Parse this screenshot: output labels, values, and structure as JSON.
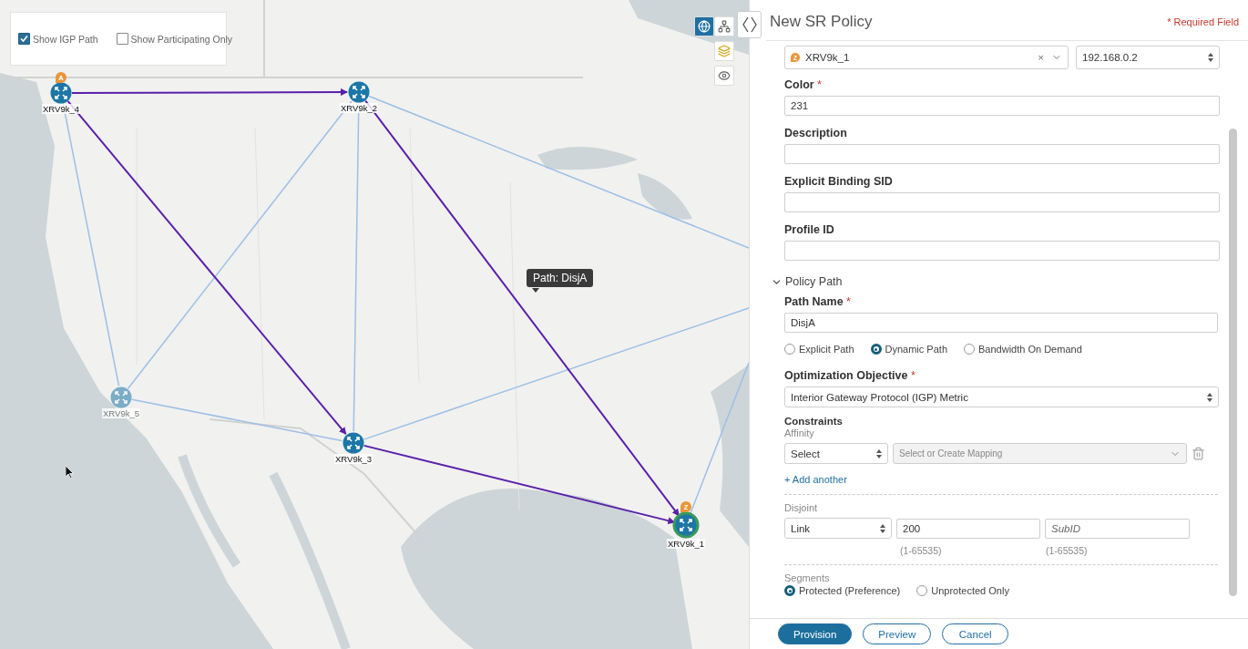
{
  "map": {
    "kind": "picture",
    "legend": [
      {
        "label": "Show IGP Path",
        "checked": true
      },
      {
        "label": "Show Participating Only",
        "checked": false
      }
    ],
    "view_toggle": [
      {
        "kind": "geo",
        "selected": true
      },
      {
        "kind": "topology",
        "selected": false
      }
    ],
    "nodes": [
      {
        "label": "XRV9k_4",
        "marker": "A",
        "dimmed": false,
        "highlighted": false
      },
      {
        "label": "XRV9k_2",
        "dimmed": false,
        "highlighted": false
      },
      {
        "label": "XRV9k_5",
        "dimmed": true,
        "highlighted": false
      },
      {
        "label": "XRV9k_3",
        "dimmed": false,
        "highlighted": false
      },
      {
        "label": "XRV9k_1",
        "marker": "Z",
        "dimmed": false,
        "highlighted": true
      }
    ],
    "links": [
      {
        "kind": "igp"
      },
      {
        "kind": "igp"
      },
      {
        "kind": "igp"
      },
      {
        "kind": "igp"
      },
      {
        "kind": "igp"
      },
      {
        "kind": "igp"
      },
      {
        "kind": "igp"
      },
      {
        "kind": "path"
      },
      {
        "kind": "path"
      },
      {
        "kind": "path"
      },
      {
        "kind": "path"
      }
    ],
    "tooltip": "Path: DisjA"
  },
  "panel": {
    "title": "New SR Policy",
    "required_note": "* Required Field",
    "endpoint": {
      "marker": "Z",
      "value": "XRV9k_1",
      "clear": "×"
    },
    "address": {
      "value": "192.168.0.2"
    },
    "fields": [
      {
        "label": "Color",
        "required": "*",
        "value": "231"
      },
      {
        "label": "Description"
      },
      {
        "label": "Explicit Binding SID"
      },
      {
        "label": "Profile ID"
      }
    ],
    "policy_path": {
      "title": "Policy Path",
      "expanded": true,
      "path_name": {
        "label": "Path Name",
        "required": "*",
        "value": "DisjA"
      },
      "path_types": [
        {
          "label": "Explicit Path",
          "selected": false
        },
        {
          "label": "Dynamic Path",
          "selected": true
        },
        {
          "label": "Bandwidth On Demand",
          "selected": false
        }
      ],
      "objective": {
        "label": "Optimization Objective",
        "required": "*",
        "value": "Interior Gateway Protocol (IGP) Metric"
      },
      "constraints": {
        "title": "Constraints",
        "affinity_label": "Affinity",
        "affinity_value": "Select",
        "mapping_placeholder": "Select or Create Mapping",
        "add_link": "+ Add another"
      },
      "disjoint": {
        "label": "Disjoint",
        "type": "Link",
        "group_id": "200",
        "sub_id_placeholder": "SubID",
        "group_hint": "(1-65535)",
        "sub_hint": "(1-65535)"
      },
      "segments": {
        "label": "Segments",
        "options": [
          {
            "label": "Protected (Preference)",
            "selected": true
          },
          {
            "label": "Unprotected Only",
            "selected": false
          }
        ]
      }
    },
    "buttons": [
      {
        "label": "Provision",
        "kind": "primary"
      },
      {
        "label": "Preview",
        "kind": "secondary"
      },
      {
        "label": "Cancel",
        "kind": "secondary"
      }
    ]
  }
}
